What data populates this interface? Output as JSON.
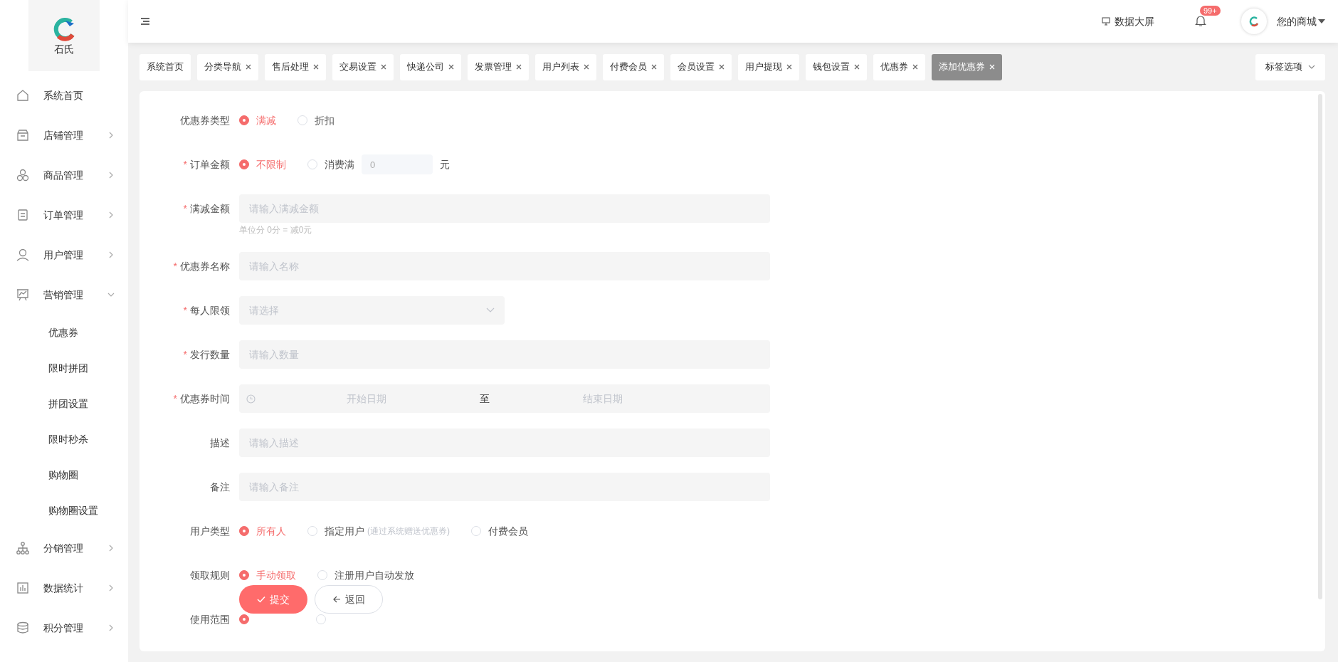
{
  "logo": {
    "title": "石氏"
  },
  "sidebar": {
    "items": [
      {
        "label": "系统首页",
        "kind": "link"
      },
      {
        "label": "店铺管理",
        "kind": "group",
        "expanded": false
      },
      {
        "label": "商品管理",
        "kind": "group",
        "expanded": false
      },
      {
        "label": "订单管理",
        "kind": "group",
        "expanded": false
      },
      {
        "label": "用户管理",
        "kind": "group",
        "expanded": false
      },
      {
        "label": "营销管理",
        "kind": "group",
        "expanded": true,
        "children": [
          {
            "label": "优惠券"
          },
          {
            "label": "限时拼团"
          },
          {
            "label": "拼团设置"
          },
          {
            "label": "限时秒杀"
          },
          {
            "label": "购物圈"
          },
          {
            "label": "购物圈设置"
          }
        ]
      },
      {
        "label": "分销管理",
        "kind": "group",
        "expanded": false
      },
      {
        "label": "数据统计",
        "kind": "group",
        "expanded": false
      },
      {
        "label": "积分管理",
        "kind": "group",
        "expanded": false
      }
    ]
  },
  "header": {
    "data_screen": "数据大屏",
    "notification_badge": "99+",
    "user": "您的商城"
  },
  "tabs": [
    {
      "label": "系统首页",
      "closable": false,
      "selected": false
    },
    {
      "label": "分类导航",
      "closable": true,
      "selected": false
    },
    {
      "label": "售后处理",
      "closable": true,
      "selected": false
    },
    {
      "label": "交易设置",
      "closable": true,
      "selected": false
    },
    {
      "label": "快递公司",
      "closable": true,
      "selected": false
    },
    {
      "label": "发票管理",
      "closable": true,
      "selected": false
    },
    {
      "label": "用户列表",
      "closable": true,
      "selected": false
    },
    {
      "label": "付费会员",
      "closable": true,
      "selected": false
    },
    {
      "label": "会员设置",
      "closable": true,
      "selected": false
    },
    {
      "label": "用户提现",
      "closable": true,
      "selected": false
    },
    {
      "label": "钱包设置",
      "closable": true,
      "selected": false
    },
    {
      "label": "优惠券",
      "closable": true,
      "selected": false
    },
    {
      "label": "添加优惠券",
      "closable": true,
      "selected": true
    }
  ],
  "tab_options": "标签选项",
  "form": {
    "rows": [
      {
        "kind": "radio",
        "label": "优惠券类型",
        "options": [
          {
            "label": "满减",
            "selected": true
          },
          {
            "label": "折扣",
            "selected": false
          }
        ]
      },
      {
        "kind": "radio",
        "label": "订单金额",
        "required_mark": "*",
        "options": [
          {
            "label": "不限制",
            "selected": true
          },
          {
            "label": "消费满",
            "selected": false
          }
        ],
        "amount_field": {
          "value": "0"
        },
        "unit": "元"
      },
      {
        "kind": "input",
        "label": "满减金额",
        "required_mark": "*",
        "placeholder": "请输入满减金额",
        "helper": "单位分 0分 = 减0元"
      },
      {
        "kind": "input",
        "label": "优惠券名称",
        "required_mark": "*",
        "placeholder": "请输入名称"
      },
      {
        "kind": "select",
        "label": "每人限领",
        "required_mark": "*",
        "placeholder": "请选择"
      },
      {
        "kind": "input",
        "label": "发行数量",
        "required_mark": "*",
        "placeholder": "请输入数量"
      },
      {
        "kind": "daterange",
        "label": "优惠券时间",
        "required_mark": "*",
        "start_placeholder": "开始日期",
        "separator": "至",
        "end_placeholder": "结束日期"
      },
      {
        "kind": "input",
        "label": "描述",
        "placeholder": "请输入描述"
      },
      {
        "kind": "input",
        "label": "备注",
        "placeholder": "请输入备注"
      },
      {
        "kind": "radio",
        "label": "用户类型",
        "options": [
          {
            "label": "所有人",
            "selected": true
          },
          {
            "label": "指定用户",
            "selected": false,
            "note": "(通过系统赠送优惠券)"
          },
          {
            "label": "付费会员",
            "selected": false
          }
        ]
      },
      {
        "kind": "radio",
        "label": "领取规则",
        "options": [
          {
            "label": "手动领取",
            "selected": true
          },
          {
            "label": "注册用户自动发放",
            "selected": false
          }
        ]
      },
      {
        "kind": "radio",
        "label": "使用范围",
        "options": [
          {
            "selected": true
          },
          {
            "selected": false
          }
        ]
      }
    ],
    "buttons": {
      "submit": "提交",
      "back": "返回"
    }
  }
}
